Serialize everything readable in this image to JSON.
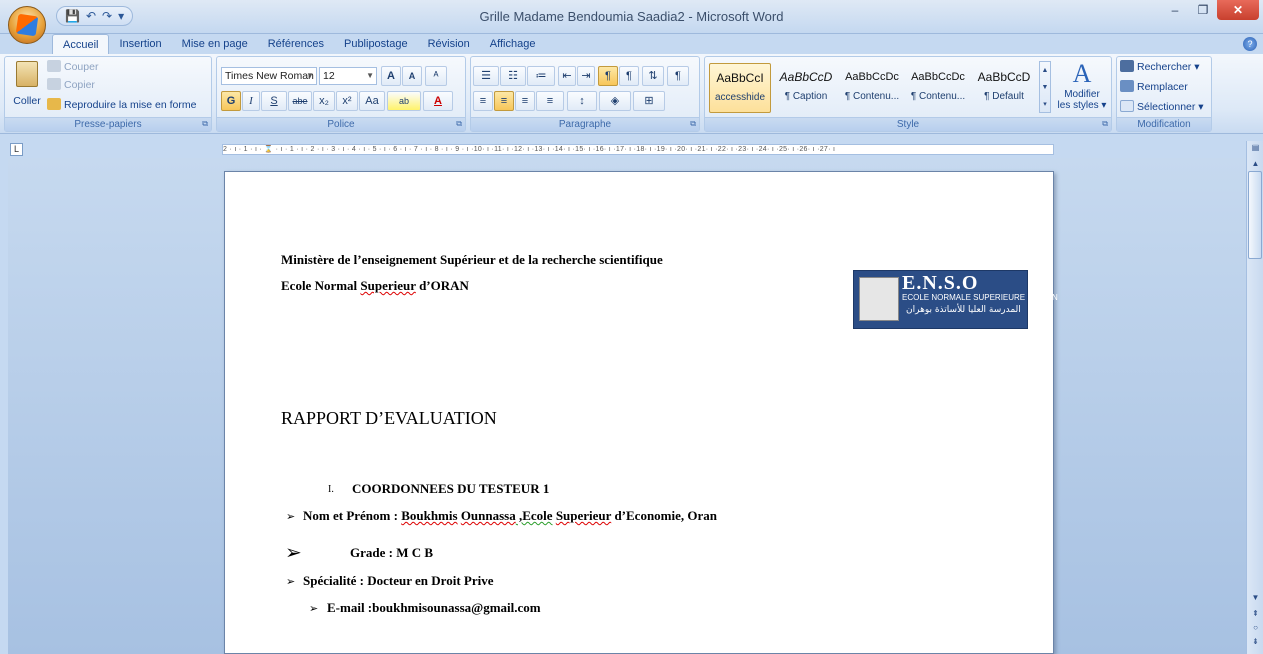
{
  "window": {
    "title": "Grille Madame Bendoumia Saadia2 - Microsoft Word",
    "minimize": "–",
    "restore": "❐",
    "close": "✕"
  },
  "qat": {
    "save": "💾",
    "undo": "↶",
    "redo": "↷",
    "more": "▾"
  },
  "tabs": [
    "Accueil",
    "Insertion",
    "Mise en page",
    "Références",
    "Publipostage",
    "Révision",
    "Affichage"
  ],
  "ribbon": {
    "clipboard": {
      "label": "Presse-papiers",
      "paste": "Coller",
      "cut": "Couper",
      "copy": "Copier",
      "format_painter": "Reproduire la mise en forme"
    },
    "font": {
      "label": "Police",
      "font_name": "Times New Roman",
      "font_size": "12",
      "grow": "A",
      "shrink": "A",
      "clear": "ᴬ",
      "bold": "G",
      "italic": "I",
      "underline": "S",
      "strike": "abe",
      "subscript": "x₂",
      "superscript": "x²",
      "case": "Aa",
      "highlight": "ab",
      "color": "A"
    },
    "paragraph": {
      "label": "Paragraphe"
    },
    "styles": {
      "label": "Style",
      "items": [
        {
          "preview": "AaBbCcI",
          "name": "accesshide"
        },
        {
          "preview": "AaBbCcD",
          "name": "¶ Caption"
        },
        {
          "preview": "AaBbCcDc",
          "name": "¶ Contenu..."
        },
        {
          "preview": "AaBbCcDc",
          "name": "¶ Contenu..."
        },
        {
          "preview": "AaBbCcD",
          "name": "¶ Default"
        }
      ],
      "change_styles_1": "Modifier",
      "change_styles_2": "les styles ▾"
    },
    "editing": {
      "label": "Modification",
      "find": "Rechercher ▾",
      "replace": "Remplacer",
      "select": "Sélectionner ▾"
    }
  },
  "ruler": {
    "corner": "L",
    "ticks": "2 · ı · 1 · ı · ⌛ · ı · 1 · ı · 2 · ı · 3 · ı · 4 · ı · 5 · ı · 6 · ı · 7 · ı · 8 · ı · 9 · ı ·10· ı ·11· ı ·12· ı ·13· ı ·14· ı ·15· ı ·16· ı ·17· ı ·18· ı ·19· ı ·20· ı ·21· ı ·22· ı ·23· ı ·24· ı ·25· ı ·26· ı ·27· ı"
  },
  "document": {
    "line1": "Ministère de l’enseignement Supérieur et de la recherche scientifique",
    "line2_a": "Ecole Normal ",
    "line2_b": "Superieur",
    "line2_c": " d’ORAN",
    "logo": {
      "title": "E.N.S.O",
      "subtitle": "ECOLE NORMALE SUPERIEURE D'ORAN",
      "arabic": "المدرسة العليا للأساتذة بوهران"
    },
    "heading": "RAPPORT D’EVALUATION",
    "section_num": "I.",
    "section_title": "COORDONNEES  DU TESTEUR  1",
    "bullet": "➢",
    "name_label": "Nom et Prénom : ",
    "name_1": "Boukhmis",
    "name_2": "Ounnassa",
    "name_3": " ,Ecole",
    "name_4": "Superieur",
    "name_5": " d’Economie, Oran",
    "grade": "Grade : M C B",
    "specialite": "Spécialité : Docteur en Droit Prive",
    "email": "E-mail :boukhmisounassa@gmail.com"
  }
}
